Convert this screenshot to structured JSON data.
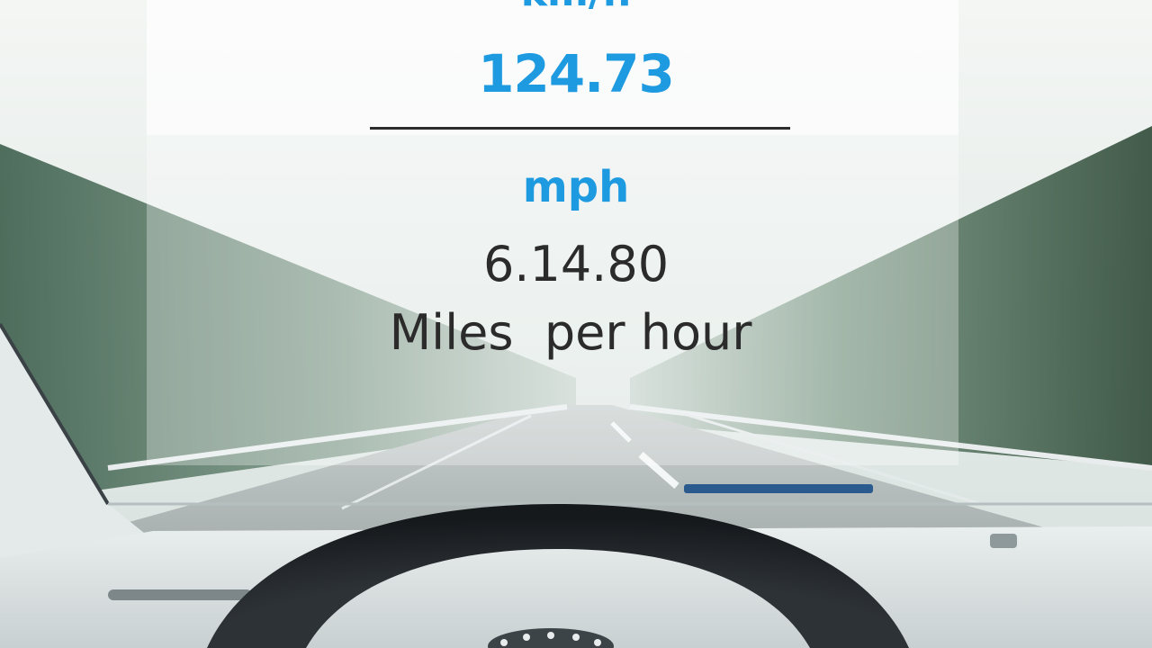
{
  "overlay": {
    "top_unit": "km/h",
    "top_value": "124.73",
    "bottom_unit": "mph",
    "bottom_value": "6.14.80",
    "bottom_caption": "Miles  per hour"
  },
  "colors": {
    "accent_blue": "#1e9ae0",
    "text_dark": "#2b2b2b"
  }
}
